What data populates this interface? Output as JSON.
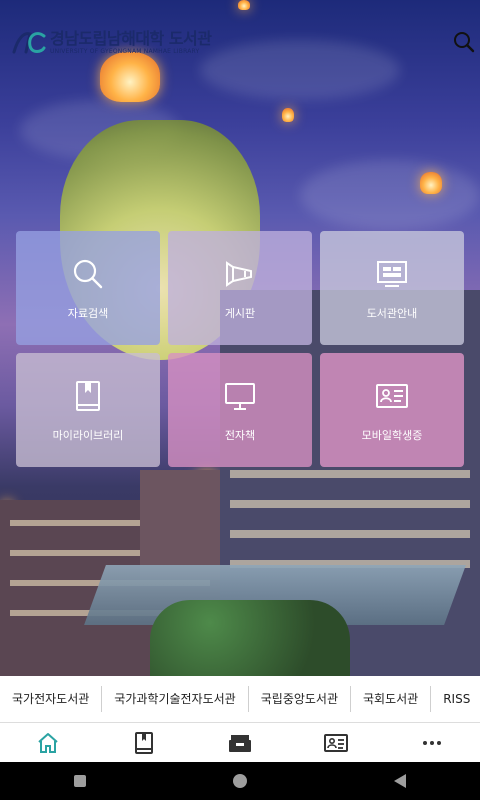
{
  "header": {
    "logo_title": "경남도립남해대학 도서관",
    "logo_subtitle": "UNIVERSITY OF GYEONGNAM NAMHAE LIBRARY",
    "search_icon": "search-icon"
  },
  "menu": [
    {
      "label": "자료검색",
      "icon": "search-icon"
    },
    {
      "label": "게시판",
      "icon": "megaphone-icon"
    },
    {
      "label": "도서관안내",
      "icon": "info-board-icon"
    },
    {
      "label": "마이라이브러리",
      "icon": "book-icon"
    },
    {
      "label": "전자책",
      "icon": "monitor-icon"
    },
    {
      "label": "모바일학생증",
      "icon": "id-card-icon"
    }
  ],
  "links": [
    "국가전자도서관",
    "국가과학기술전자도서관",
    "국립중앙도서관",
    "국회도서관",
    "RISS"
  ],
  "bottom_nav": [
    {
      "name": "home",
      "icon": "home-icon"
    },
    {
      "name": "book",
      "icon": "book-icon"
    },
    {
      "name": "basket",
      "icon": "basket-icon"
    },
    {
      "name": "id-card",
      "icon": "id-card-icon"
    },
    {
      "name": "more",
      "icon": "more-icon"
    }
  ],
  "colors": {
    "brand": "#1b2a6b",
    "accent": "#2aa3a3",
    "nav_icon": "#333333"
  }
}
